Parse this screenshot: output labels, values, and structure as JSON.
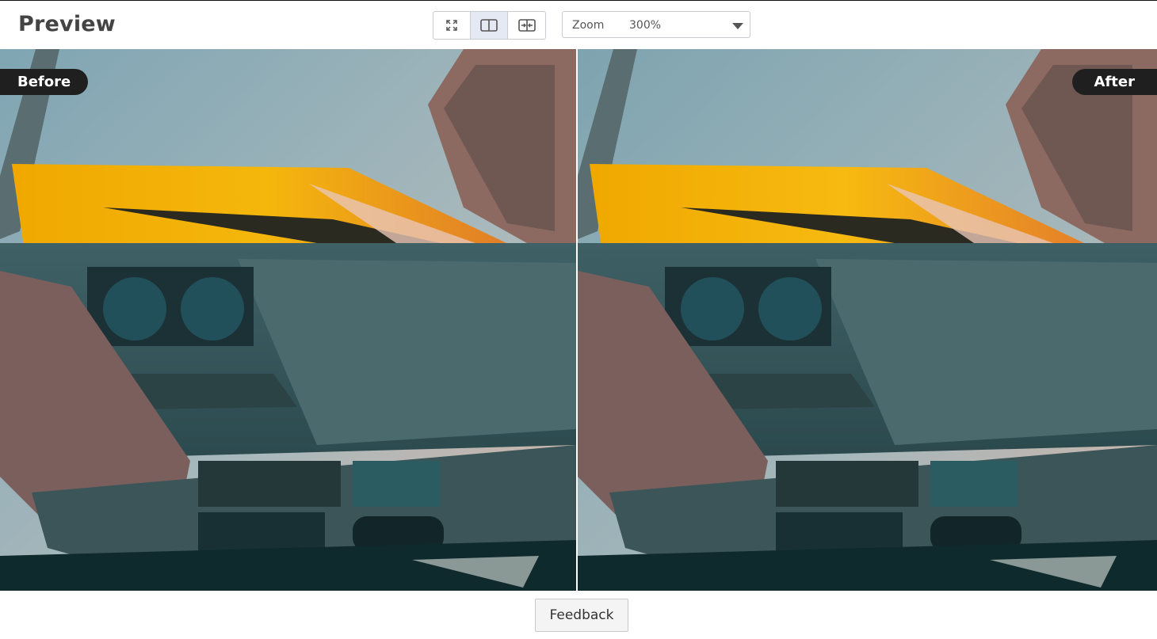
{
  "header": {
    "title": "Preview",
    "view_modes": [
      {
        "name": "fullscreen",
        "icon": "fullscreen-icon",
        "active": false
      },
      {
        "name": "split",
        "icon": "split-view-icon",
        "active": true
      },
      {
        "name": "slider",
        "icon": "slider-compare-icon",
        "active": false
      }
    ],
    "zoom": {
      "label": "Zoom",
      "value": "300%",
      "icon": "chevron-down-icon"
    }
  },
  "viewer": {
    "before_label": "Before",
    "after_label": "After"
  },
  "footer": {
    "feedback_label": "Feedback"
  },
  "colors": {
    "badge_bg": "#1f1f1f",
    "active_toggle_bg": "#e4e9f3",
    "border": "#c9ccd3"
  }
}
